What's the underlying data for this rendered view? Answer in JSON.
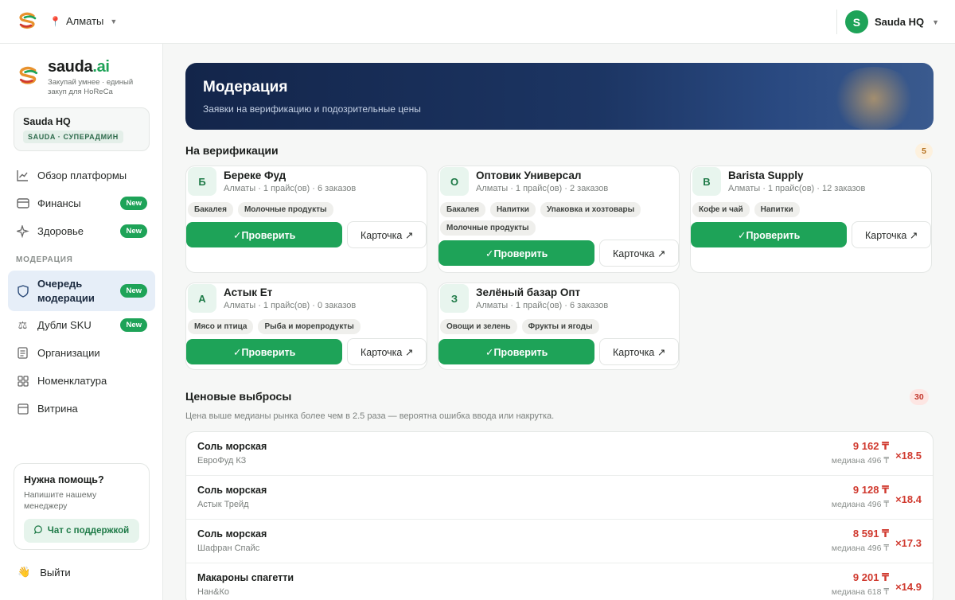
{
  "topbar": {
    "city": "Алматы",
    "user_initial": "S",
    "user_name": "Sauda HQ"
  },
  "brand": {
    "name_main": "sauda",
    "name_dot": ".ai",
    "tagline": "Закупай умнее · единый закуп для HoReCa"
  },
  "org": {
    "name": "Sauda HQ",
    "role": "SAUDA · СУПЕРАДМИН"
  },
  "nav": {
    "items_top": [
      {
        "label": "Обзор платформы",
        "badge": ""
      },
      {
        "label": "Финансы",
        "badge": "New"
      },
      {
        "label": "Здоровье",
        "badge": "New"
      }
    ],
    "section_label": "МОДЕРАЦИЯ",
    "items_mod": [
      {
        "label": "Очередь модерации",
        "badge": "New"
      },
      {
        "label": "Дубли SKU",
        "badge": "New"
      },
      {
        "label": "Организации",
        "badge": ""
      },
      {
        "label": "Номенклатура",
        "badge": ""
      },
      {
        "label": "Витрина",
        "badge": ""
      }
    ]
  },
  "help": {
    "title": "Нужна помощь?",
    "subtitle": "Напишите нашему менеджеру",
    "button": "Чат с поддержкой"
  },
  "logout": {
    "label": "Выйти"
  },
  "hero": {
    "title": "Модерация",
    "subtitle": "Заявки на верификацию и подозрительные цены"
  },
  "verification": {
    "title": "На верификации",
    "count": "5",
    "check_label": "✓Проверить",
    "card_label": "Карточка ↗",
    "cards": [
      {
        "letter": "Б",
        "name": "Береке Фуд",
        "meta": "Алматы · 1 прайс(ов) · 6 заказов",
        "tags": [
          "Бакалея",
          "Молочные продукты"
        ]
      },
      {
        "letter": "О",
        "name": "Оптовик Универсал",
        "meta": "Алматы · 1 прайс(ов) · 2 заказов",
        "tags": [
          "Бакалея",
          "Напитки",
          "Упаковка и хозтовары",
          "Молочные продукты"
        ]
      },
      {
        "letter": "B",
        "name": "Barista Supply",
        "meta": "Алматы · 1 прайс(ов) · 12 заказов",
        "tags": [
          "Кофе и чай",
          "Напитки"
        ]
      },
      {
        "letter": "А",
        "name": "Астык Ет",
        "meta": "Алматы · 1 прайс(ов) · 0 заказов",
        "tags": [
          "Мясо и птица",
          "Рыба и морепродукты"
        ]
      },
      {
        "letter": "З",
        "name": "Зелёный базар Опт",
        "meta": "Алматы · 1 прайс(ов) · 6 заказов",
        "tags": [
          "Овощи и зелень",
          "Фрукты и ягоды"
        ]
      }
    ]
  },
  "outliers": {
    "title": "Ценовые выбросы",
    "count": "30",
    "note": "Цена выше медианы рынка более чем в 2.5 раза — вероятна ошибка ввода или накрутка.",
    "rows": [
      {
        "name": "Соль морская",
        "supplier": "ЕвроФуд КЗ",
        "price": "9 162 ₸",
        "median": "медиана 496 ₸",
        "ratio": "×18.5"
      },
      {
        "name": "Соль морская",
        "supplier": "Астык Трейд",
        "price": "9 128 ₸",
        "median": "медиана 496 ₸",
        "ratio": "×18.4"
      },
      {
        "name": "Соль морская",
        "supplier": "Шафран Спайс",
        "price": "8 591 ₸",
        "median": "медиана 496 ₸",
        "ratio": "×17.3"
      },
      {
        "name": "Макароны спагетти",
        "supplier": "Нан&Ко",
        "price": "9 201 ₸",
        "median": "медиана 618 ₸",
        "ratio": "×14.9"
      }
    ]
  },
  "colors": {
    "accent": "#1ea358",
    "danger": "#d0392e",
    "hero_start": "#13254a",
    "hero_end": "#3a5a8e",
    "active_nav": "#e6eef8"
  }
}
